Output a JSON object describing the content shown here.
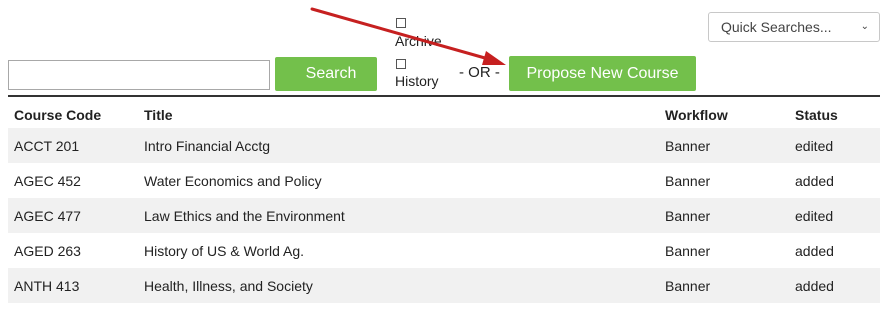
{
  "quick_searches": {
    "label": "Quick Searches...",
    "chevron_icon": "chevron-down-icon"
  },
  "search": {
    "value": "",
    "placeholder": "",
    "button_label": "Search"
  },
  "filters": {
    "archive_label": "Archive",
    "history_label": "History"
  },
  "or_text": "- OR -",
  "propose_button_label": "Propose New Course",
  "colors": {
    "accent": "#73c04b",
    "annotation_arrow": "#c62020"
  },
  "table": {
    "headers": {
      "code": "Course Code",
      "title": "Title",
      "workflow": "Workflow",
      "status": "Status"
    },
    "rows": [
      {
        "code": "ACCT 201",
        "title": "Intro Financial Acctg",
        "workflow": "Banner",
        "status": "edited"
      },
      {
        "code": "AGEC 452",
        "title": "Water Economics and Policy",
        "workflow": "Banner",
        "status": "added"
      },
      {
        "code": "AGEC 477",
        "title": "Law Ethics and the Environment",
        "workflow": "Banner",
        "status": "edited"
      },
      {
        "code": "AGED 263",
        "title": "History of US & World Ag.",
        "workflow": "Banner",
        "status": "added"
      },
      {
        "code": "ANTH 413",
        "title": "Health, Illness, and Society",
        "workflow": "Banner",
        "status": "added"
      }
    ]
  }
}
